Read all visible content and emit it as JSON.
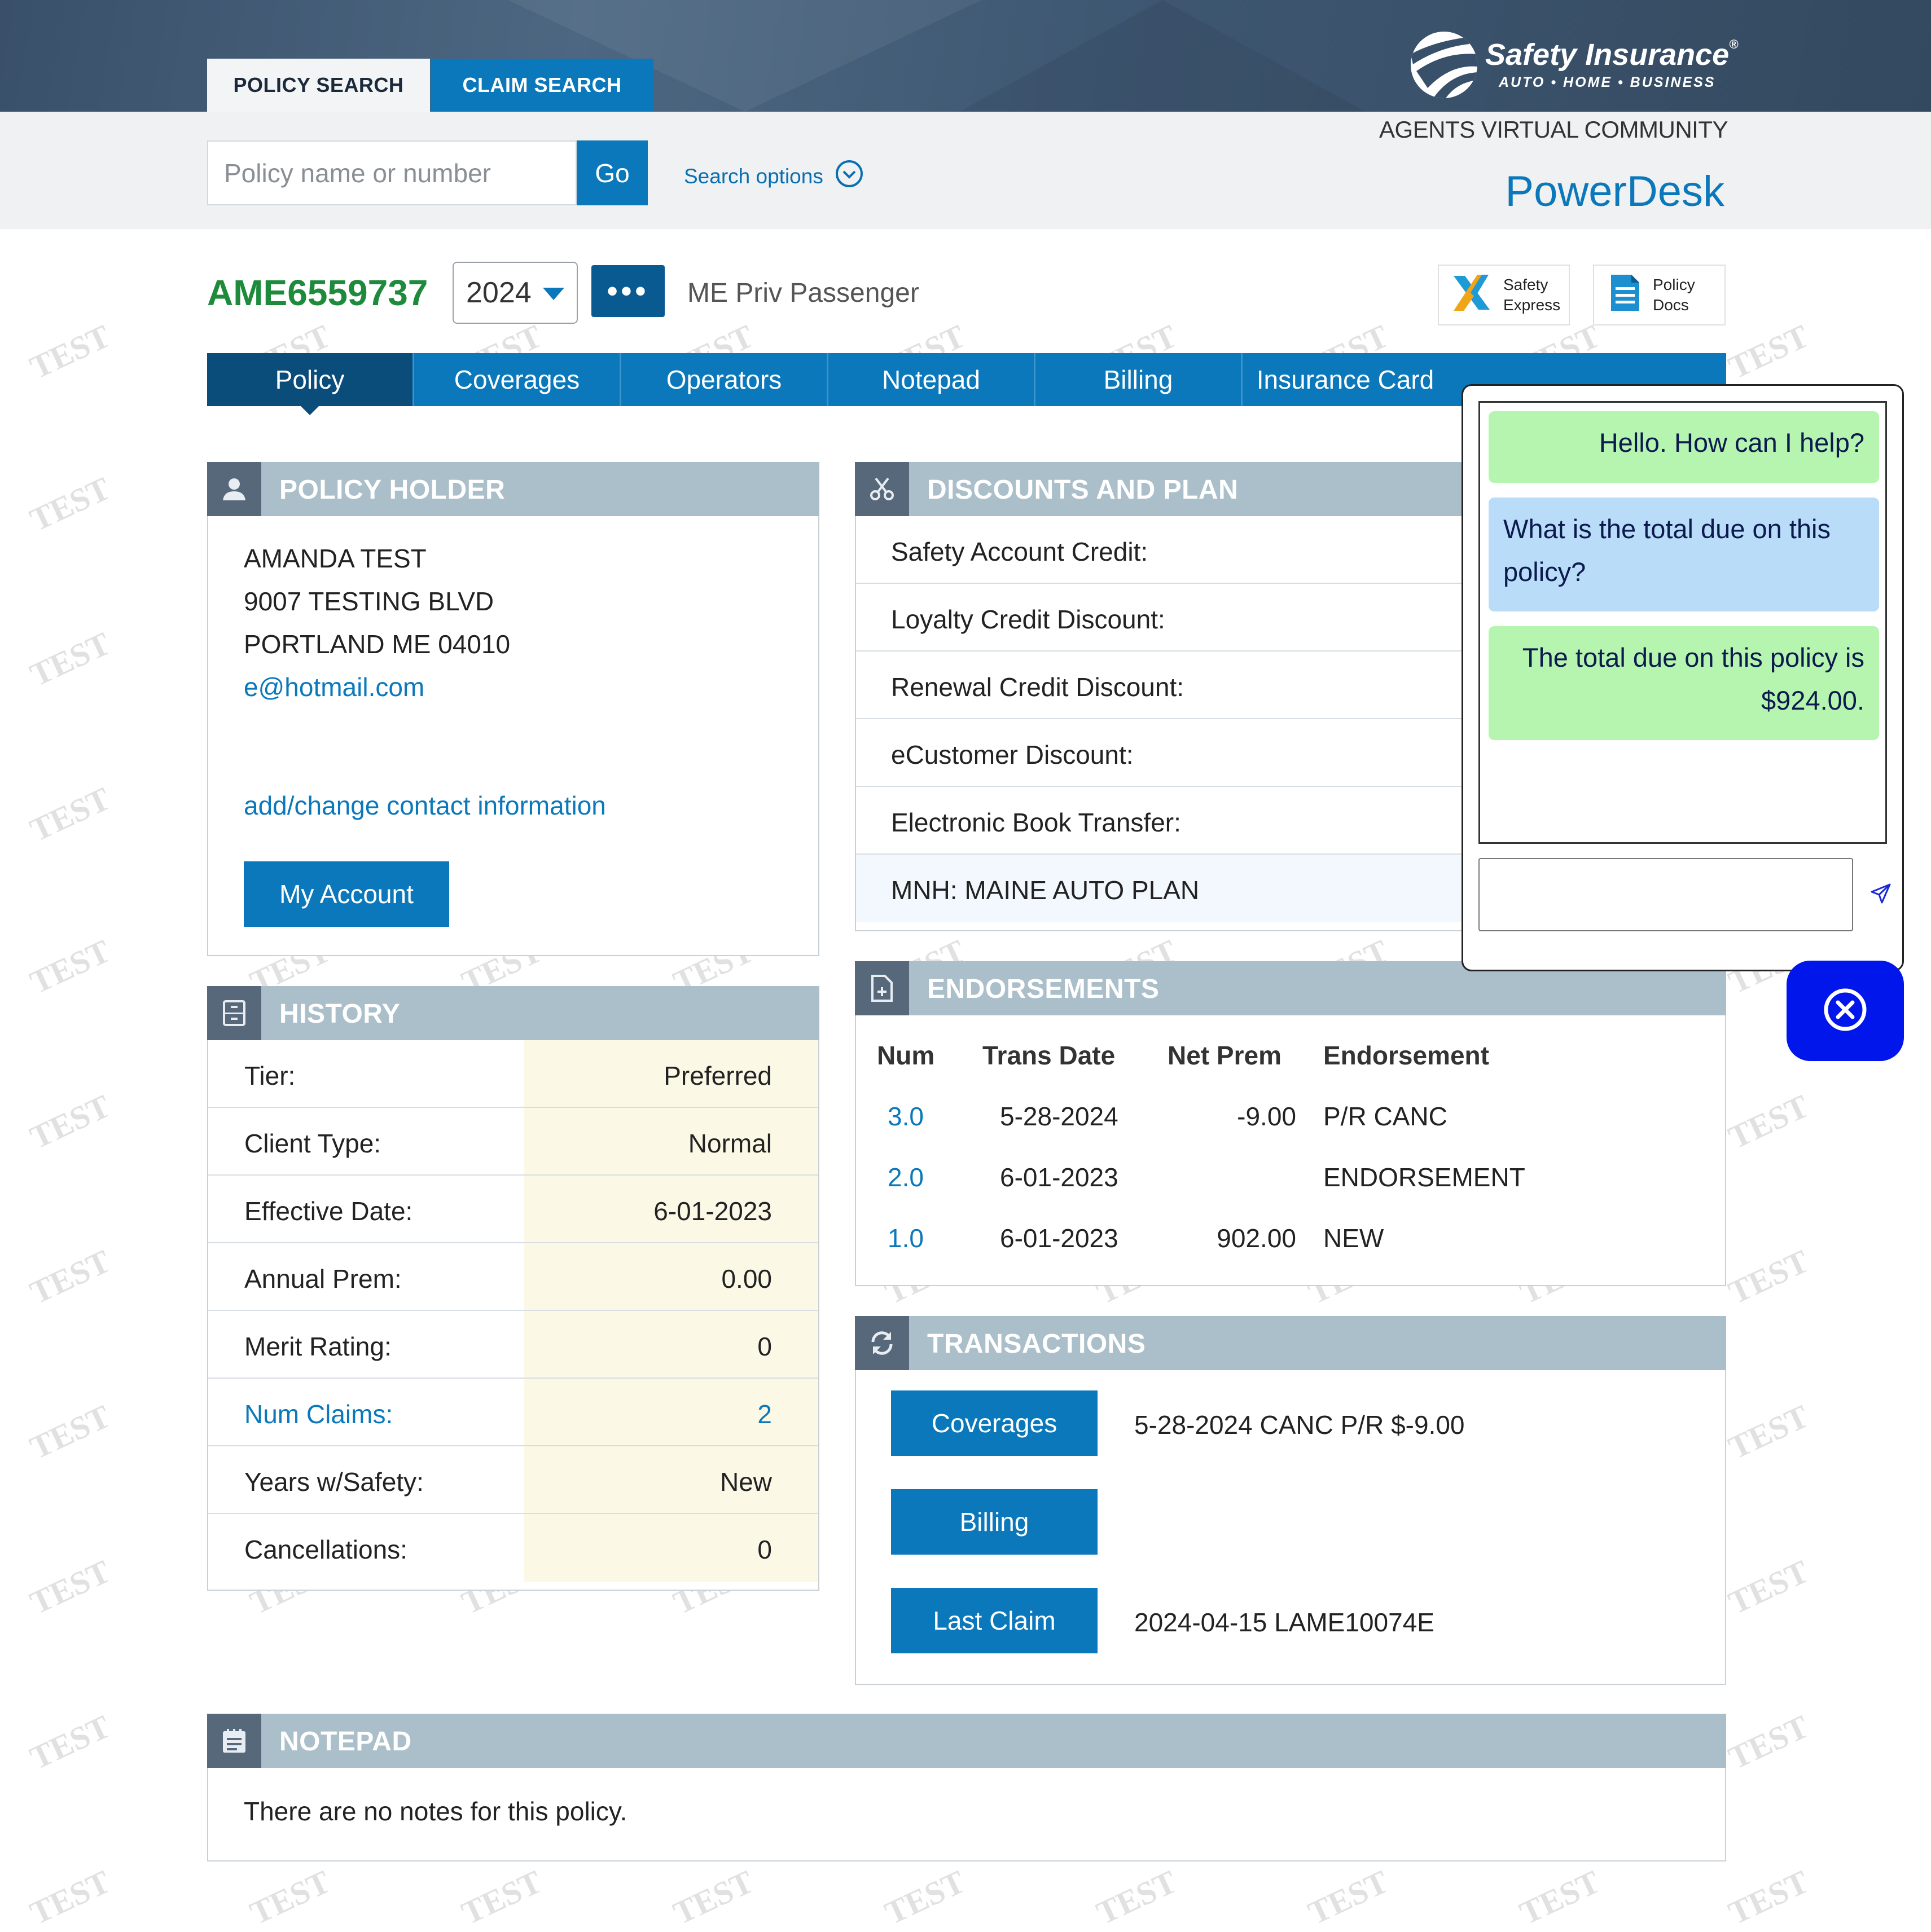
{
  "header": {
    "tabs": {
      "policy_search": "POLICY SEARCH",
      "claim_search": "CLAIM SEARCH"
    },
    "brand": {
      "name": "Safety Insurance",
      "registered": "®",
      "tagline": "AUTO • HOME • BUSINESS"
    },
    "community_label": "AGENTS VIRTUAL COMMUNITY",
    "app_title": "PowerDesk",
    "search": {
      "placeholder": "Policy name or number",
      "go_label": "Go",
      "options_label": "Search options"
    }
  },
  "policy": {
    "number": "AME6559737",
    "year": "2024",
    "more_label": "•••",
    "type": "ME Priv Passenger",
    "quick_links": [
      {
        "line1": "Safety",
        "line2": "Express",
        "icon": "safety-express-x-icon"
      },
      {
        "line1": "Policy",
        "line2": "Docs",
        "icon": "document-icon"
      }
    ]
  },
  "nav": {
    "tabs": [
      "Policy",
      "Coverages",
      "Operators",
      "Notepad",
      "Billing",
      "Insurance Card"
    ],
    "active": "Policy"
  },
  "policy_holder": {
    "title": "POLICY HOLDER",
    "name": "AMANDA TEST",
    "address1": "9007 TESTING BLVD",
    "address2": "PORTLAND ME 04010",
    "email": "e@hotmail.com",
    "contact_link": "add/change contact information",
    "account_button": "My Account"
  },
  "history": {
    "title": "HISTORY",
    "rows": [
      {
        "label": "Tier:",
        "value": "Preferred"
      },
      {
        "label": "Client Type:",
        "value": "Normal"
      },
      {
        "label": "Effective Date:",
        "value": "6-01-2023"
      },
      {
        "label": "Annual Prem:",
        "value": "0.00"
      },
      {
        "label": "Merit Rating:",
        "value": "0"
      },
      {
        "label": "Num Claims:",
        "value": "2"
      },
      {
        "label": "Years w/Safety:",
        "value": "New"
      },
      {
        "label": "Cancellations:",
        "value": "0"
      }
    ]
  },
  "discounts": {
    "title": "DISCOUNTS AND PLAN",
    "rows": [
      "Safety Account Credit:",
      "Loyalty Credit Discount:",
      "Renewal Credit Discount:",
      "eCustomer Discount:",
      "Electronic Book Transfer:",
      "MNH: MAINE AUTO PLAN"
    ]
  },
  "endorsements": {
    "title": "ENDORSEMENTS",
    "headers": [
      "Num",
      "Trans Date",
      "Net Prem",
      "Endorsement"
    ],
    "rows": [
      {
        "num": "3.0",
        "date": "5-28-2024",
        "prem": "-9.00",
        "type": "P/R CANC"
      },
      {
        "num": "2.0",
        "date": "6-01-2023",
        "prem": "",
        "type": "ENDORSEMENT"
      },
      {
        "num": "1.0",
        "date": "6-01-2023",
        "prem": "902.00",
        "type": "NEW"
      }
    ]
  },
  "transactions": {
    "title": "TRANSACTIONS",
    "rows": [
      {
        "button": "Coverages",
        "detail": "5-28-2024 CANC P/R $-9.00"
      },
      {
        "button": "Billing",
        "detail": ""
      },
      {
        "button": "Last Claim",
        "detail": "2024-04-15 LAME10074E"
      }
    ]
  },
  "notepad": {
    "title": "NOTEPAD",
    "empty_text": "There are no notes for this policy."
  },
  "chat": {
    "messages": [
      {
        "role": "bot",
        "text": "Hello. How can I help?"
      },
      {
        "role": "user",
        "text": "What is the total due on this policy?"
      },
      {
        "role": "bot",
        "text": "The total due on this policy is $924.00."
      }
    ],
    "input_value": ""
  },
  "watermark": "TEST",
  "colors": {
    "brand_blue": "#0a78ba",
    "active_tab": "#0a4d7b",
    "policy_number_green": "#1e8a3c",
    "panel_header": "#abbfca",
    "chat_bot": "#b6f5b0",
    "chat_user": "#b9dcf9",
    "chat_close": "#0016ea"
  }
}
